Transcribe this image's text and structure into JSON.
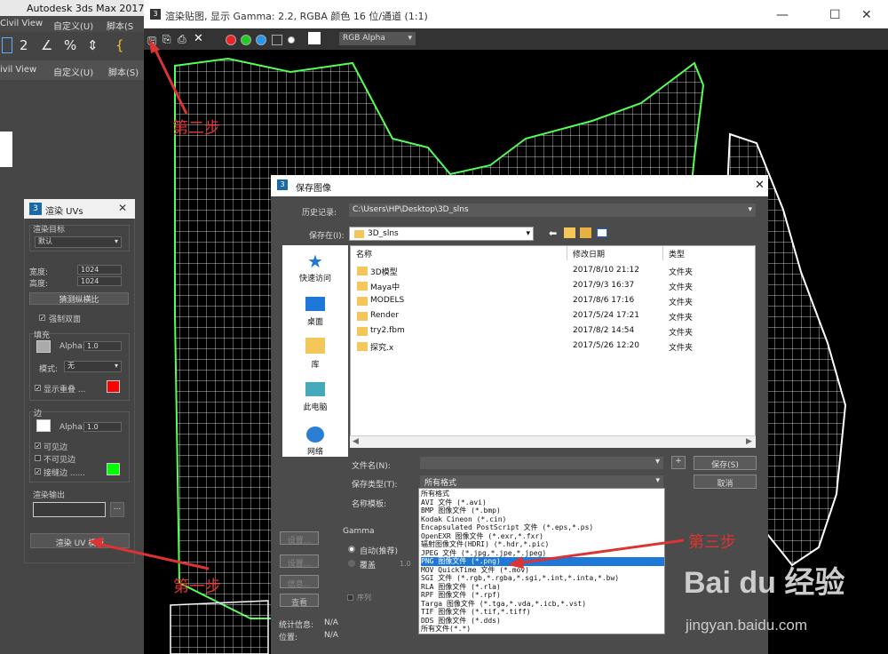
{
  "max": {
    "app_title": "Autodesk 3ds Max 2017",
    "menu1": [
      "Civil View",
      "自定义(U)",
      "脚本(S"
    ],
    "menu2": [
      "ivil View",
      "自定义(U)",
      "脚本(S)"
    ]
  },
  "render_uvs": {
    "title": "渲染 UVs",
    "target_label": "渲染目标",
    "target_value": "默认",
    "width_label": "宽度:",
    "width_value": "1024",
    "height_label": "高度:",
    "height_value": "1024",
    "guess_ratio": "猜测纵横比",
    "force_2side": "强制双面",
    "fill_label": "填充",
    "alpha_label": "Alpha:",
    "fill_alpha": "1.0",
    "mode_label": "模式:",
    "mode_value": "无",
    "show_overlap": "显示重叠 ...",
    "edge_label": "边",
    "edge_alpha": "1.0",
    "visible_edges": "可见边",
    "invisible_edges": "不可见边",
    "seam_edges": "接缝边 ......",
    "output_label": "渲染输出",
    "render_button": "渲染 UV 模板",
    "browse": "...",
    "overlap_color": "#ff0000",
    "seam_color": "#00ff00"
  },
  "render_window": {
    "title": "渲染贴图, 显示 Gamma: 2.2, RGBA 颜色 16 位/通道 (1:1)",
    "channel": "RGB Alpha",
    "controls": [
      "—",
      "☐",
      "✕"
    ]
  },
  "save_dialog": {
    "title": "保存图像",
    "history_label": "历史记录:",
    "history_value": "C:\\Users\\HP\\Desktop\\3D_slns",
    "save_in_label": "保存在(I):",
    "save_in_value": "3D_slns",
    "places": [
      "快速访问",
      "桌面",
      "库",
      "此电脑",
      "网络"
    ],
    "columns": [
      "名称",
      "修改日期",
      "类型"
    ],
    "files": [
      {
        "name": "3D模型",
        "date": "2017/8/10 21:12",
        "type": "文件夹"
      },
      {
        "name": "Maya中",
        "date": "2017/9/3 16:37",
        "type": "文件夹"
      },
      {
        "name": "MODELS",
        "date": "2017/8/6 17:16",
        "type": "文件夹"
      },
      {
        "name": "Render",
        "date": "2017/5/24 17:21",
        "type": "文件夹"
      },
      {
        "name": "try2.fbm",
        "date": "2017/8/2 14:54",
        "type": "文件夹"
      },
      {
        "name": "探究.x",
        "date": "2017/5/26 12:20",
        "type": "文件夹"
      }
    ],
    "filename_label": "文件名(N):",
    "filetype_label": "保存类型(T):",
    "filetype_value": "所有格式",
    "template_label": "名称模板:",
    "save_button": "保存(S)",
    "cancel_button": "取消",
    "plus": "+",
    "types": [
      "所有格式",
      "AVI 文件 (*.avi)",
      "BMP 图像文件 (*.bmp)",
      "Kodak Cineon (*.cin)",
      "Encapsulated PostScript 文件 (*.eps,*.ps)",
      "OpenEXR 图像文件 (*.exr,*.fxr)",
      "辐射图像文件(HDRI) (*.hdr,*.pic)",
      "JPEG 文件 (*.jpg,*.jpe,*.jpeg)",
      "PNG 图像文件 (*.png)",
      "MOV QuickTime 文件 (*.mov)",
      "SGI 文件 (*.rgb,*.rgba,*.sgi,*.int,*.inta,*.bw)",
      "RLA 图像文件 (*.rla)",
      "RPF 图像文件 (*.rpf)",
      "Targa 图像文件 (*.tga,*.vda,*.icb,*.vst)",
      "TIF 图像文件 (*.tif,*.tiff)",
      "DDS 图像文件 (*.dds)",
      "所有文件(*.*)"
    ],
    "selected_type_index": 8,
    "gamma_label": "Gamma",
    "gamma_auto": "自动(推荐)",
    "gamma_override": "覆盖",
    "gamma_override_value": "1.0",
    "settings_btn": "设置...",
    "info_btn": "信息...",
    "view_btn": "查看",
    "sequence": "序列",
    "stats_label": "统计信息:",
    "stats_value": "N/A",
    "location_label": "位置:",
    "location_value": "N/A"
  },
  "annotations": {
    "step1": "第一步",
    "step2": "第二步",
    "step3": "第三步"
  },
  "watermark": {
    "brand": "Bai du 经验",
    "url": "jingyan.baidu.com"
  }
}
